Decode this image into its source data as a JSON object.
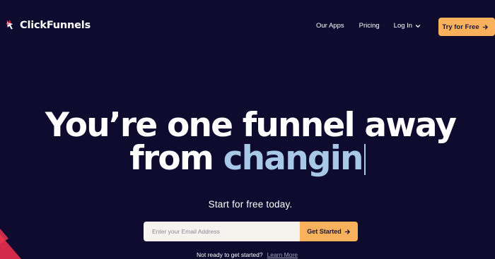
{
  "header": {
    "logo_text": "ClickFunnels",
    "nav": {
      "apps_label": "Our Apps",
      "pricing_label": "Pricing",
      "login_label": "Log In"
    },
    "cta_label": "Try for Free"
  },
  "hero": {
    "line1": "You’re one funnel away",
    "line2_prefix": "from ",
    "line2_accent": "changin",
    "subheading": "Start for free today."
  },
  "signup": {
    "email_placeholder": "Enter your Email Address",
    "email_value": "",
    "submit_label": "Get Started"
  },
  "footer_prompt": {
    "text": "Not ready to get started?",
    "link_label": "Learn More"
  },
  "colors": {
    "background": "#0e0b2e",
    "accent_orange": "#f9b25b",
    "headline_accent": "#a8c8e8",
    "logo_red": "#e8344e",
    "corner_red": "#d42a4a"
  },
  "icons": {
    "logo": "clickfunnels-logo-icon",
    "login_dropdown": "chevron-down-icon",
    "cta_arrow": "arrow-right-icon",
    "submit_arrow": "arrow-right-icon"
  }
}
